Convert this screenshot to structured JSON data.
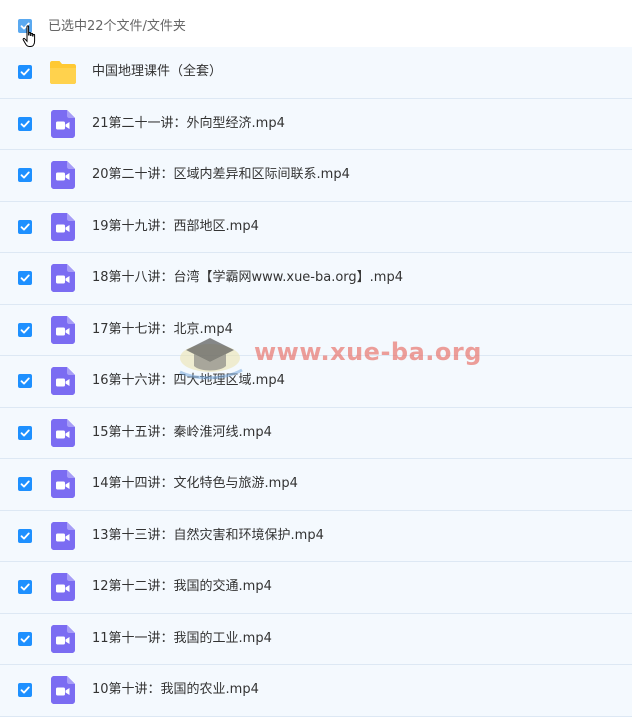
{
  "header": {
    "selection_label": "已选中22个文件/文件夹",
    "select_all_checked": true
  },
  "files": [
    {
      "type": "folder",
      "name": "中国地理课件（全套）",
      "checked": true
    },
    {
      "type": "video",
      "name": "21第二十一讲：外向型经济.mp4",
      "checked": true
    },
    {
      "type": "video",
      "name": "20第二十讲：区域内差异和区际间联系.mp4",
      "checked": true
    },
    {
      "type": "video",
      "name": "19第十九讲：西部地区.mp4",
      "checked": true
    },
    {
      "type": "video",
      "name": "18第十八讲：台湾【学霸网www.xue-ba.org】.mp4",
      "checked": true
    },
    {
      "type": "video",
      "name": "17第十七讲：北京.mp4",
      "checked": true
    },
    {
      "type": "video",
      "name": "16第十六讲：四大地理区域.mp4",
      "checked": true
    },
    {
      "type": "video",
      "name": "15第十五讲：秦岭淮河线.mp4",
      "checked": true
    },
    {
      "type": "video",
      "name": "14第十四讲：文化特色与旅游.mp4",
      "checked": true
    },
    {
      "type": "video",
      "name": "13第十三讲：自然灾害和环境保护.mp4",
      "checked": true
    },
    {
      "type": "video",
      "name": "12第十二讲：我国的交通.mp4",
      "checked": true
    },
    {
      "type": "video",
      "name": "11第十一讲：我国的工业.mp4",
      "checked": true
    },
    {
      "type": "video",
      "name": "10第十讲：我国的农业.mp4",
      "checked": true
    }
  ],
  "watermark": {
    "text": "www.xue-ba.org"
  },
  "colors": {
    "checkbox": "#1e90ff",
    "folder": "#ffc933",
    "video_icon": "#7b6cf2",
    "row_bg": "#f4f9fe",
    "row_border": "#dde8f4",
    "watermark": "#e6645a"
  },
  "icons": {
    "folder": "folder-icon",
    "video": "video-file-icon",
    "checkbox": "checkbox-checked-icon",
    "cursor": "hand-pointer-icon"
  }
}
